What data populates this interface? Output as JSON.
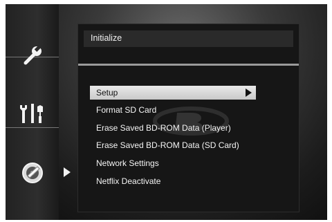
{
  "header": {
    "title": "Initialize"
  },
  "sidebar": {
    "items": [
      {
        "icon": "wrench-icon"
      },
      {
        "icon": "tools-icon"
      },
      {
        "icon": "disc-settings-icon"
      }
    ],
    "selected_index": 2
  },
  "menu": {
    "items": [
      {
        "label": "Setup",
        "selected": true,
        "has_submenu": true
      },
      {
        "label": "Format SD Card"
      },
      {
        "label": "Erase Saved BD-ROM Data (Player)"
      },
      {
        "label": "Erase Saved BD-ROM Data (SD Card)"
      },
      {
        "label": "Network Settings"
      },
      {
        "label": "Netflix Deactivate"
      }
    ]
  },
  "colors": {
    "highlight": "#dcdcdc",
    "text": "#f5f5f5",
    "background": "#161616"
  }
}
